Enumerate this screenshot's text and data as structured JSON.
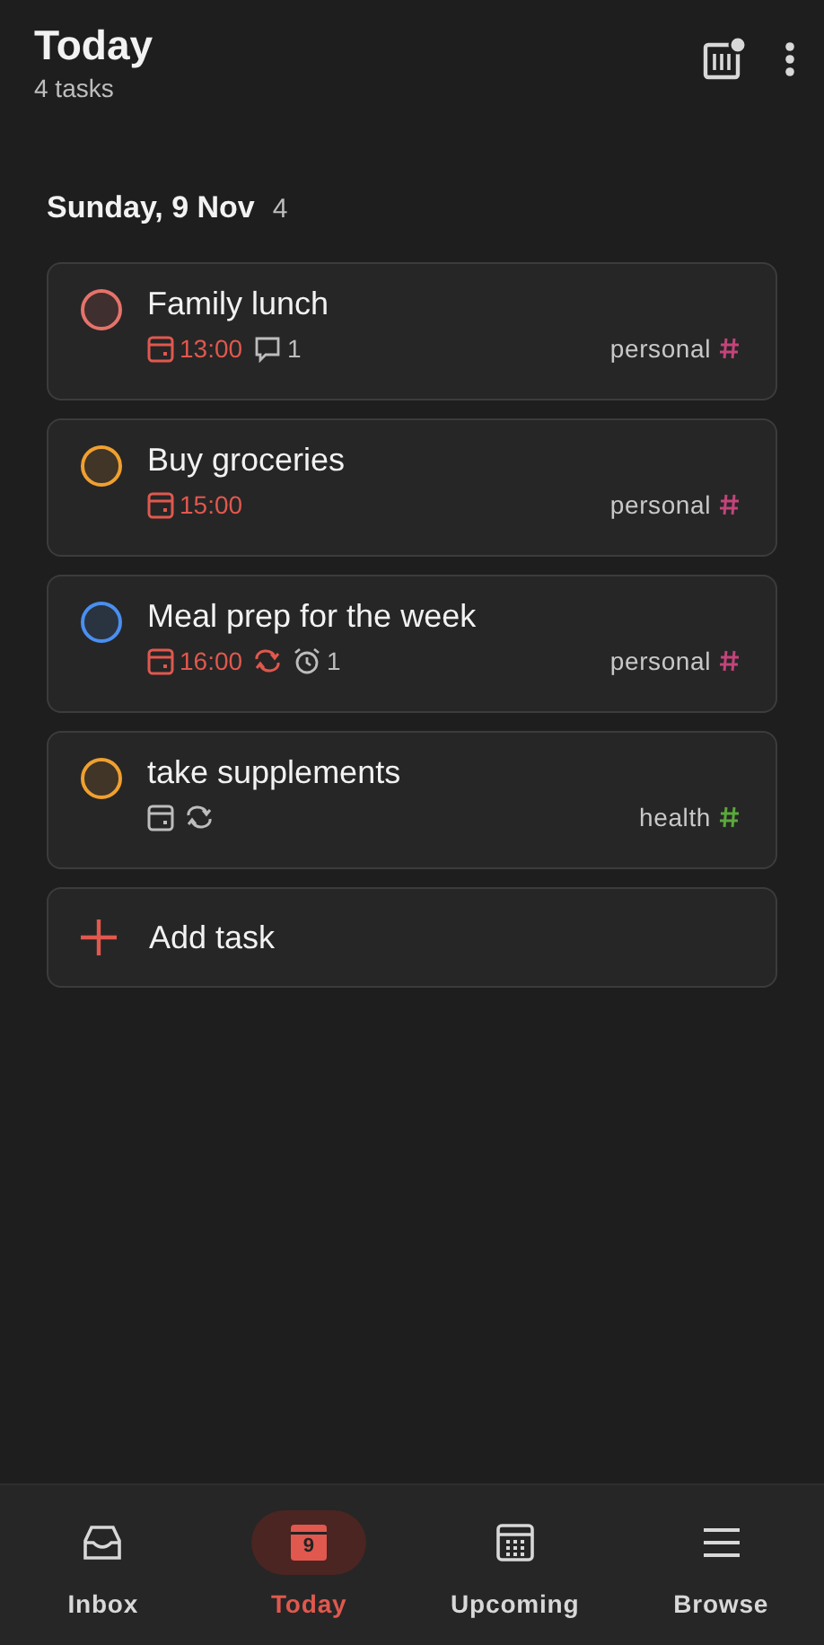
{
  "header": {
    "title": "Today",
    "subtitle": "4 tasks",
    "stats_badge": true
  },
  "section": {
    "title": "Sunday, 9 Nov",
    "count": "4"
  },
  "tasks": [
    {
      "title": "Family lunch",
      "color": "#e5736b",
      "due_highlight": true,
      "meta": [
        {
          "kind": "date",
          "text": "13:00"
        },
        {
          "kind": "comment",
          "text": "1"
        }
      ],
      "tag": {
        "label": "personal",
        "color": "#c2447a"
      }
    },
    {
      "title": "Buy groceries",
      "color": "#f0a030",
      "due_highlight": true,
      "meta": [
        {
          "kind": "date",
          "text": "15:00"
        }
      ],
      "tag": {
        "label": "personal",
        "color": "#c2447a"
      }
    },
    {
      "title": "Meal prep for the week",
      "color": "#4a8ff0",
      "due_highlight": true,
      "meta": [
        {
          "kind": "date",
          "text": "16:00"
        },
        {
          "kind": "recurring"
        },
        {
          "kind": "reminder",
          "text": "1"
        }
      ],
      "tag": {
        "label": "personal",
        "color": "#c2447a"
      }
    },
    {
      "title": "take supplements",
      "color": "#f0a030",
      "due_highlight": false,
      "meta": [
        {
          "kind": "date"
        },
        {
          "kind": "recurring"
        }
      ],
      "tag": {
        "label": "health",
        "color": "#5aa83c"
      }
    }
  ],
  "add_task": {
    "label": "Add task"
  },
  "nav": [
    {
      "kind": "inbox",
      "label": "Inbox",
      "selected": false
    },
    {
      "kind": "today",
      "label": "Today",
      "icon_text": "9",
      "selected": true
    },
    {
      "kind": "upcoming",
      "label": "Upcoming",
      "selected": false
    },
    {
      "kind": "browse",
      "label": "Browse",
      "selected": false
    }
  ]
}
